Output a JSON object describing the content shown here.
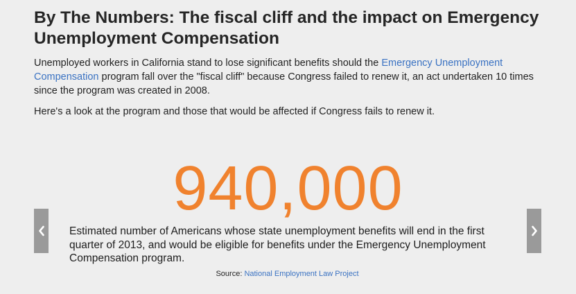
{
  "article": {
    "title": "By The Numbers: The fiscal cliff and the impact on Emergency Unemployment Compensation",
    "intro_before_link": "Unemployed workers in California stand to lose significant benefits should the ",
    "intro_link": "Emergency Unemployment Compensation",
    "intro_after_link": " program fall over the \"fiscal cliff\" because Congress failed to renew it, an act undertaken 10 times since the program was created in 2008.",
    "lead": "Here's a look at the program and those that would be affected if Congress fails to renew it."
  },
  "slide": {
    "number": "940,000",
    "description": "Estimated number of Americans whose state unemployment benefits will end in the first quarter of 2013, and would be eligible for benefits under the Emergency Unemployment Compensation program.",
    "source_label": "Source: ",
    "source_link": "National Employment Law Project"
  },
  "icons": {
    "prev": "chevron-left-icon",
    "next": "chevron-right-icon"
  },
  "colors": {
    "background": "#eeeeee",
    "highlight_number": "#f0822e",
    "link": "#3a72c2",
    "nav_button": "#9a9a9a"
  }
}
